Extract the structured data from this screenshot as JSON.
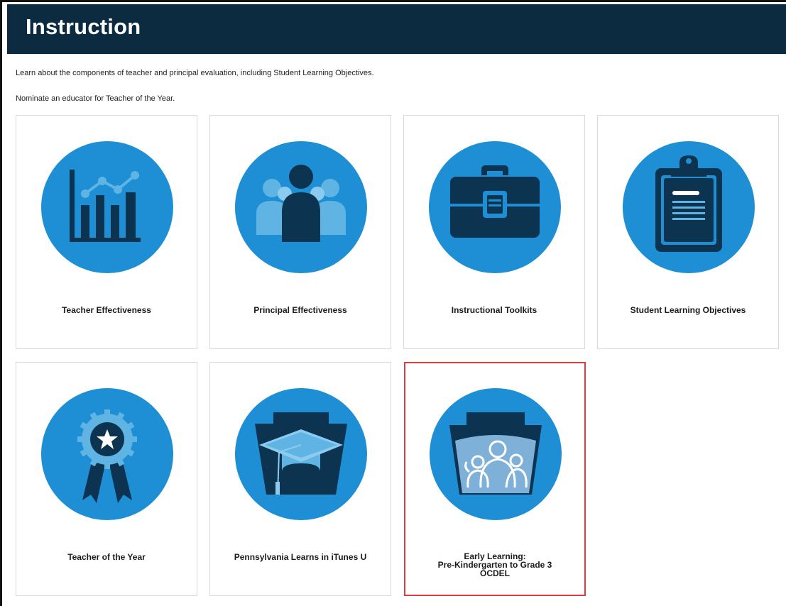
{
  "page": {
    "title": "Instruction",
    "intro_line_1": "Learn about the components of teacher and principal evaluation, including Student Learning Objectives.",
    "intro_line_2": "Nominate an educator for Teacher of the Year."
  },
  "colors": {
    "banner": "#0c2b40",
    "circle": "#1e8fd5",
    "icon_dark": "#0c3350",
    "icon_light": "#5fb4e3",
    "highlight_border": "#e0393e"
  },
  "tiles": [
    {
      "label": "Teacher Effectiveness",
      "icon": "bar-chart-icon"
    },
    {
      "label": "Principal Effectiveness",
      "icon": "people-group-icon"
    },
    {
      "label": "Instructional Toolkits",
      "icon": "toolbox-icon"
    },
    {
      "label": "Student Learning Objectives",
      "icon": "clipboard-icon"
    },
    {
      "label": "Teacher of the Year",
      "icon": "award-ribbon-icon"
    },
    {
      "label": "Pennsylvania Learns in iTunes U",
      "icon": "graduation-cap-keystone-icon"
    },
    {
      "label_lines": [
        "Early Learning:",
        "Pre-Kindergarten to Grade 3",
        "OCDEL"
      ],
      "icon": "family-keystone-icon",
      "highlighted": true
    }
  ]
}
